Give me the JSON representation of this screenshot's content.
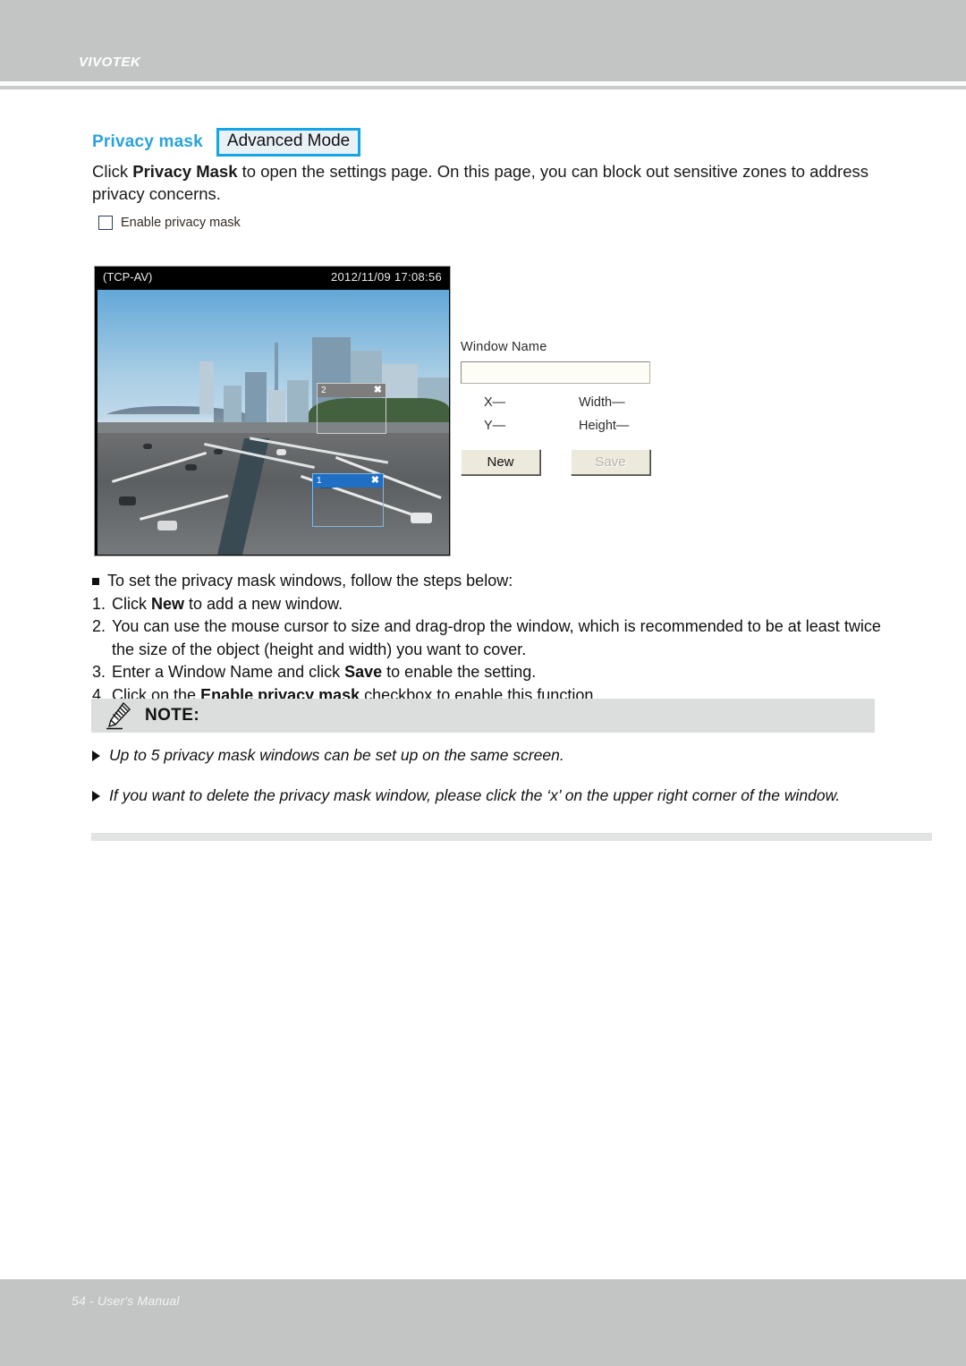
{
  "header": {
    "brand": "VIVOTEK"
  },
  "page": {
    "title": "Privacy mask",
    "mode_badge": "Advanced Mode",
    "intro_lead": "Click ",
    "intro_bold": "Privacy Mask",
    "intro_rest": " to open the settings page. On this page, you can block out sensitive zones to address privacy concerns.",
    "accent_color": "#2aa3dc",
    "badge_border_color": "#15a5e6"
  },
  "enable": {
    "label": "Enable privacy mask",
    "checked": false
  },
  "video": {
    "osd_stream": "(TCP-AV)",
    "osd_datetime": "2012/11/09  17:08:56",
    "masks": [
      {
        "id": "2",
        "label": "2",
        "close": "✖",
        "state": "inactive",
        "color": "#7d7d7d"
      },
      {
        "id": "1",
        "label": "1",
        "close": "✖",
        "state": "selected",
        "color": "#1f6fc4"
      }
    ]
  },
  "panel": {
    "window_name_label": "Window Name",
    "window_name_value": "",
    "window_name_placeholder": "",
    "x_label": "X—",
    "y_label": "Y—",
    "width_label": "Width—",
    "height_label": "Height—",
    "new_button": "New",
    "save_button": "Save",
    "save_disabled": true
  },
  "steps": {
    "intro": "To set the privacy mask windows, follow the steps below:",
    "items": [
      {
        "num": "1.",
        "pre": "Click ",
        "bold": "New",
        "post": " to add a new window."
      },
      {
        "num": "2.",
        "pre": "You can use the mouse cursor to size and drag-drop the window, which is recommended to be at least twice the size of the object (height and width) you want to cover.",
        "bold": "",
        "post": ""
      },
      {
        "num": "3.",
        "pre": "Enter a Window Name and click ",
        "bold": "Save",
        "post": " to enable the setting."
      },
      {
        "num": "4.",
        "pre": "Click on the ",
        "bold": "Enable privacy mask",
        "post": " checkbox to enable this function."
      }
    ]
  },
  "note": {
    "title": "NOTE:",
    "items": [
      "Up to 5 privacy mask windows can be set up on the same screen.",
      "If you want to delete the privacy mask window, please click the ‘x’ on the upper right corner of the window."
    ]
  },
  "footer": {
    "text": "54 - User's Manual"
  }
}
